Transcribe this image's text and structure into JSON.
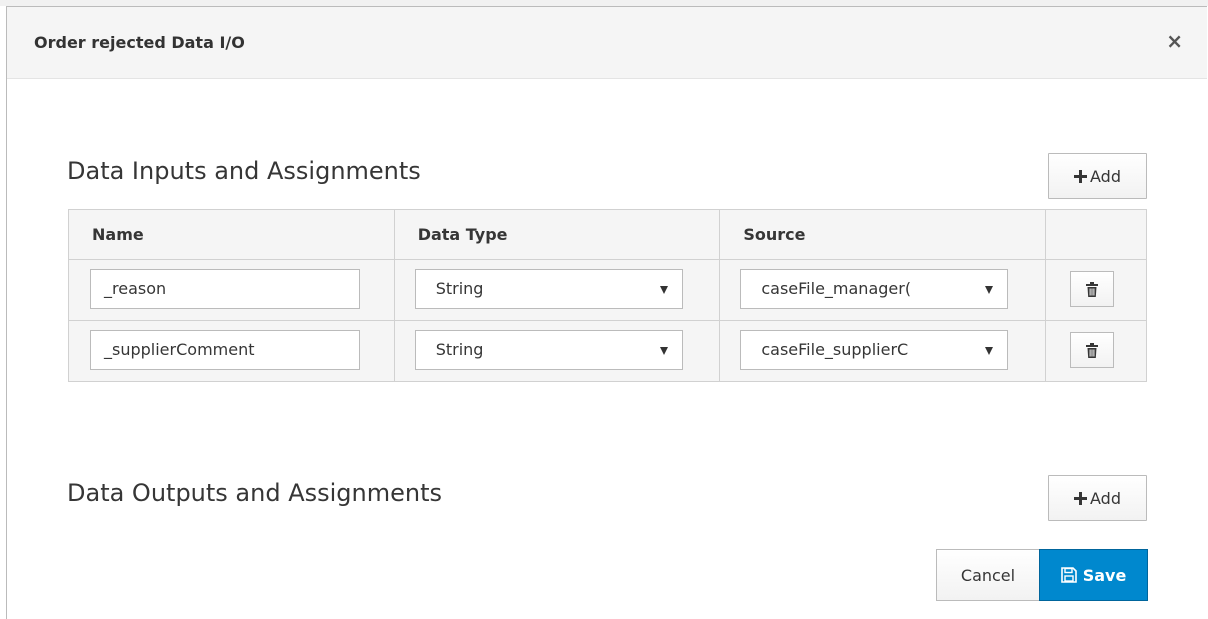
{
  "dialog": {
    "title": "Order rejected Data I/O",
    "close_label": "×"
  },
  "inputs_section": {
    "title": "Data Inputs and Assignments",
    "add_label": "Add",
    "columns": [
      "Name",
      "Data Type",
      "Source"
    ],
    "rows": [
      {
        "name": "_reason",
        "data_type": "String",
        "source": "caseFile_manager("
      },
      {
        "name": "_supplierComment",
        "data_type": "String",
        "source": "caseFile_supplierC"
      }
    ]
  },
  "outputs_section": {
    "title": "Data Outputs and Assignments",
    "add_label": "Add"
  },
  "footer": {
    "cancel_label": "Cancel",
    "save_label": "Save"
  },
  "colors": {
    "primary": "#0088ce",
    "header_bg": "#f5f5f5",
    "border": "#bbbbbb"
  },
  "icons": {
    "add": "plus-icon",
    "delete": "trash-icon",
    "save": "floppy-disk-icon",
    "close": "close-icon",
    "dropdown": "caret-down-icon"
  }
}
